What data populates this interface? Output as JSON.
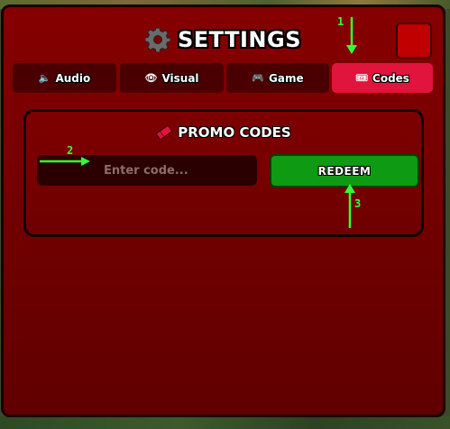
{
  "window": {
    "title": "SETTINGS"
  },
  "tabs": [
    {
      "label": "Audio",
      "icon": "speaker-icon",
      "active": false
    },
    {
      "label": "Visual",
      "icon": "eye-icon",
      "active": false
    },
    {
      "label": "Game",
      "icon": "gamepad-icon",
      "active": false
    },
    {
      "label": "Codes",
      "icon": "ticket-icon",
      "active": true
    }
  ],
  "promo": {
    "title": "PROMO CODES",
    "input_placeholder": "Enter code...",
    "input_value": "",
    "redeem_label": "REDEEM"
  },
  "annotations": [
    "1",
    "2",
    "3"
  ],
  "colors": {
    "panel": "#800000",
    "tab": "#4a0000",
    "tab_active": "#e0143c",
    "redeem": "#0e9a12",
    "close": "#c00000",
    "annotation": "#33ff33"
  }
}
